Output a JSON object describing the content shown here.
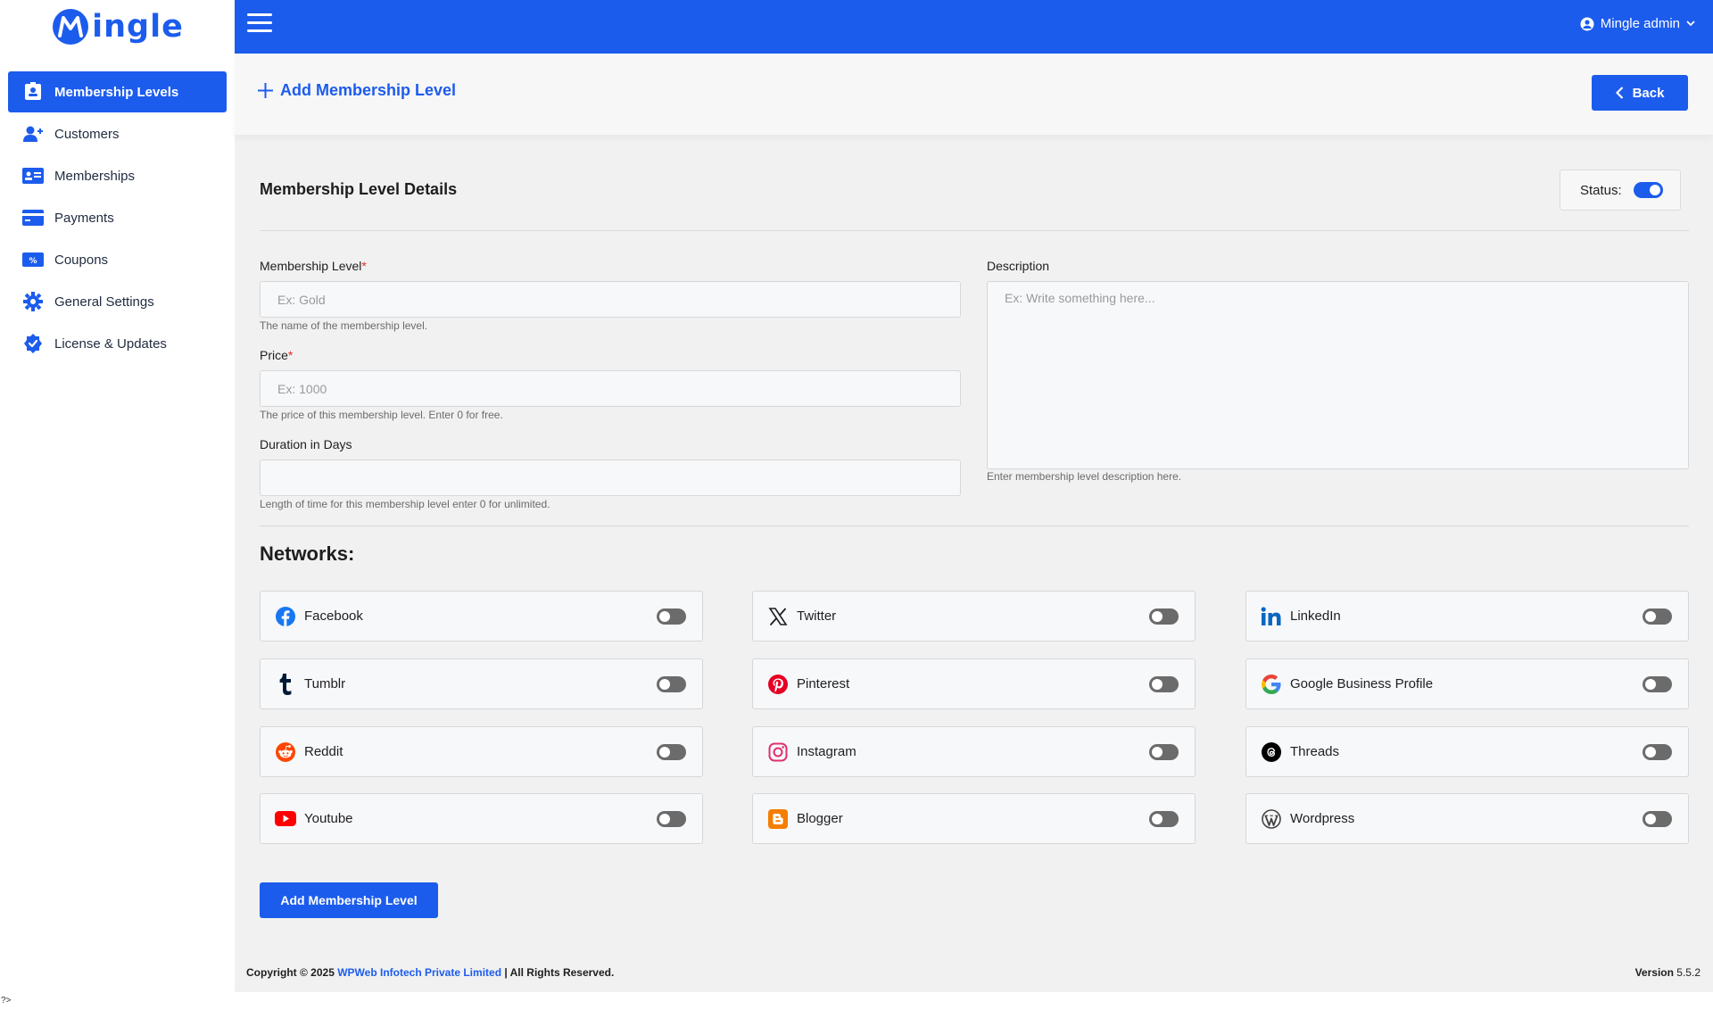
{
  "brand": {
    "name": "ingle",
    "color": "#1c5ced"
  },
  "sidebar": {
    "items": [
      {
        "label": "Membership Levels",
        "icon": "id-badge-icon",
        "active": true
      },
      {
        "label": "Customers",
        "icon": "user-plus-icon"
      },
      {
        "label": "Memberships",
        "icon": "id-card-icon"
      },
      {
        "label": "Payments",
        "icon": "credit-card-icon"
      },
      {
        "label": "Coupons",
        "icon": "coupon-icon"
      },
      {
        "label": "General Settings",
        "icon": "gear-icon"
      },
      {
        "label": "License & Updates",
        "icon": "verified-badge-icon"
      }
    ]
  },
  "topbar": {
    "user_label": "Mingle admin"
  },
  "header": {
    "title": "Add Membership Level",
    "back_label": "Back"
  },
  "form": {
    "section_title": "Membership Level Details",
    "status_label": "Status:",
    "status_on": true,
    "membership_level": {
      "label": "Membership Level",
      "required": "*",
      "placeholder": "Ex: Gold",
      "value": "",
      "help": "The name of the membership level."
    },
    "price": {
      "label": "Price",
      "required": "*",
      "placeholder": "Ex: 1000",
      "value": "",
      "help": "The price of this membership level. Enter 0 for free."
    },
    "duration": {
      "label": "Duration in Days",
      "placeholder": "",
      "value": "",
      "help": "Length of time for this membership level enter 0 for unlimited."
    },
    "description": {
      "label": "Description",
      "placeholder": "Ex: Write something here...",
      "value": "",
      "help": "Enter membership level description here."
    }
  },
  "networks": {
    "title": "Networks:",
    "items": [
      {
        "name": "Facebook",
        "icon": "facebook-icon",
        "enabled": false
      },
      {
        "name": "Twitter",
        "icon": "x-twitter-icon",
        "enabled": false
      },
      {
        "name": "LinkedIn",
        "icon": "linkedin-icon",
        "enabled": false
      },
      {
        "name": "Tumblr",
        "icon": "tumblr-icon",
        "enabled": false
      },
      {
        "name": "Pinterest",
        "icon": "pinterest-icon",
        "enabled": false
      },
      {
        "name": "Google Business Profile",
        "icon": "google-icon",
        "enabled": false
      },
      {
        "name": "Reddit",
        "icon": "reddit-icon",
        "enabled": false
      },
      {
        "name": "Instagram",
        "icon": "instagram-icon",
        "enabled": false
      },
      {
        "name": "Threads",
        "icon": "threads-icon",
        "enabled": false
      },
      {
        "name": "Youtube",
        "icon": "youtube-icon",
        "enabled": false
      },
      {
        "name": "Blogger",
        "icon": "blogger-icon",
        "enabled": false
      },
      {
        "name": "Wordpress",
        "icon": "wordpress-icon",
        "enabled": false
      }
    ]
  },
  "submit_label": "Add Membership Level",
  "footer": {
    "copyright_prefix": "Copyright © 2025",
    "company": "WPWeb Infotech Private Limited",
    "rights": "| All Rights Reserved.",
    "version_label": "Version",
    "version": "5.5.2"
  },
  "stray_text": "?>"
}
